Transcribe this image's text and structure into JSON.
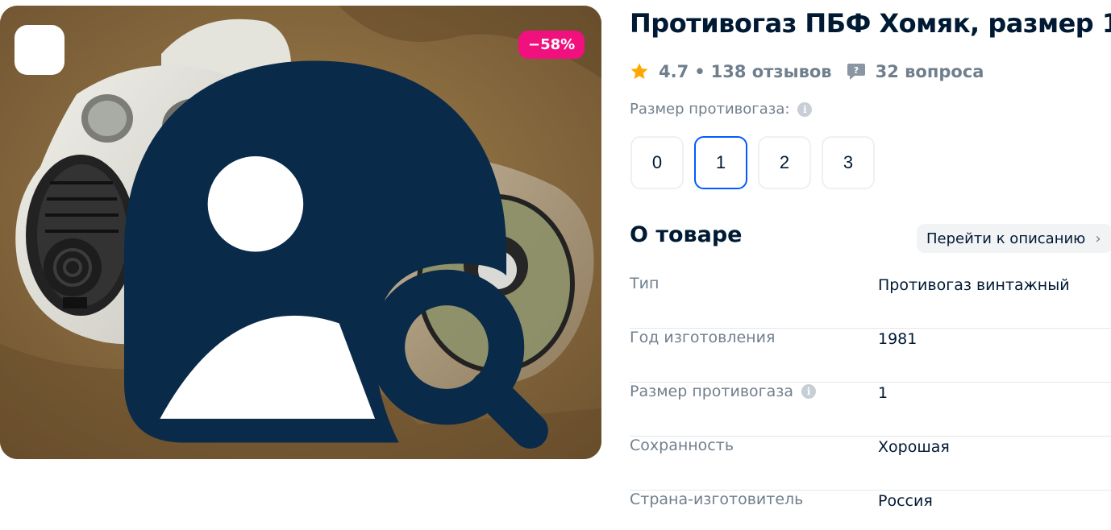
{
  "product": {
    "title": "Противогаз ПБФ Хомяк, размер 1",
    "discount": "−58%",
    "image_alt": "Противогаз"
  },
  "rating": {
    "score": "4.7",
    "dot": "•",
    "reviews": "138 отзывов",
    "questions": "32 вопроса"
  },
  "size_selector": {
    "label": "Размер противогаза:",
    "options": [
      "0",
      "1",
      "2",
      "3"
    ],
    "selected": "1"
  },
  "about": {
    "title": "О товаре",
    "goto_label": "Перейти к описанию",
    "specs": [
      {
        "key": "Тип",
        "value": "Противогаз винтажный"
      },
      {
        "key": "Год изготовления",
        "value": "1981"
      },
      {
        "key": "Размер противогаза",
        "value": "1"
      },
      {
        "key": "Сохранность",
        "value": "Хорошая"
      },
      {
        "key": "Страна-изготовитель",
        "value": "Россия"
      }
    ]
  },
  "icons": {
    "photo_search": "image-search-icon",
    "star": "star-icon",
    "question": "question-bubble-icon",
    "info": "info-icon",
    "chevron": "chevron-right-icon"
  },
  "colors": {
    "accent": "#005bff",
    "discount": "#f1117e",
    "star": "#ffa800",
    "muted": "#707f8d",
    "text": "#001a34"
  }
}
